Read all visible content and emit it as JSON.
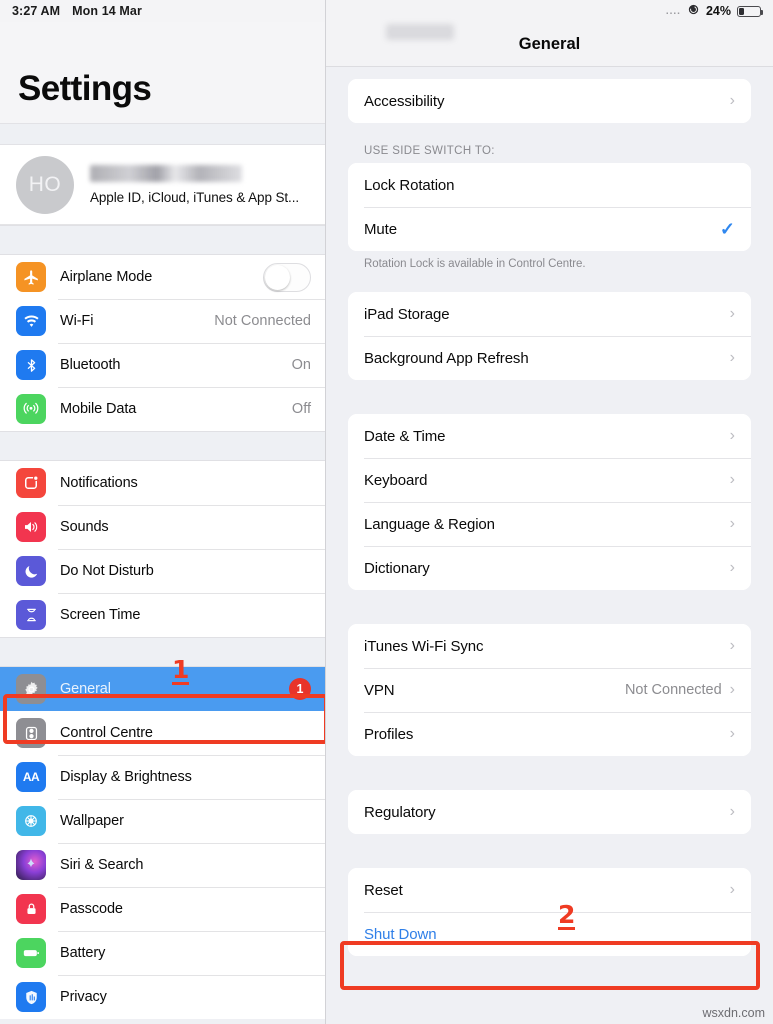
{
  "status_bar": {
    "time": "3:27 AM",
    "date": "Mon 14 Mar",
    "signal_dots": "....",
    "rotation_lock_icon": "rotation-lock-icon",
    "battery_percent": "24%"
  },
  "sidebar": {
    "title": "Settings",
    "account": {
      "avatar_initials": "HO",
      "name_redacted": "",
      "subtitle": "Apple ID, iCloud, iTunes & App St..."
    },
    "groups": [
      {
        "items": [
          {
            "label": "Airplane Mode",
            "icon": "airplane-icon",
            "icon_color": "#f59324",
            "glyph": "✈",
            "control": "toggle",
            "toggle_on": false
          },
          {
            "label": "Wi-Fi",
            "icon": "wifi-icon",
            "icon_color": "#1f7af0",
            "glyph": "◓",
            "value": "Not Connected"
          },
          {
            "label": "Bluetooth",
            "icon": "bluetooth-icon",
            "icon_color": "#1f7af0",
            "glyph": "ᛦ",
            "value": "On"
          },
          {
            "label": "Mobile Data",
            "icon": "mobile-data-icon",
            "icon_color": "#4cd55f",
            "glyph": "(·)",
            "value": "Off"
          }
        ]
      },
      {
        "items": [
          {
            "label": "Notifications",
            "icon": "notifications-icon",
            "icon_color": "#f4463c",
            "glyph": "▢"
          },
          {
            "label": "Sounds",
            "icon": "sounds-icon",
            "icon_color": "#f2354f",
            "glyph": "🔊"
          },
          {
            "label": "Do Not Disturb",
            "icon": "do-not-disturb-icon",
            "icon_color": "#5b59d8",
            "glyph": "☾"
          },
          {
            "label": "Screen Time",
            "icon": "screen-time-icon",
            "icon_color": "#5b59d8",
            "glyph": "⧖"
          }
        ]
      },
      {
        "items": [
          {
            "label": "General",
            "icon": "gear-icon",
            "icon_color": "#8e8e93",
            "glyph": "⚙",
            "selected": true,
            "badge": "1"
          },
          {
            "label": "Control Centre",
            "icon": "control-centre-icon",
            "icon_color": "#8e8e93",
            "glyph": "⚇"
          },
          {
            "label": "Display & Brightness",
            "icon": "display-brightness-icon",
            "icon_color": "#1f7af0",
            "glyph": "AA"
          },
          {
            "label": "Wallpaper",
            "icon": "wallpaper-icon",
            "icon_color": "#41b7e8",
            "glyph": "✿"
          },
          {
            "label": "Siri & Search",
            "icon": "siri-icon",
            "icon_color": "#3b2b52",
            "glyph": "✦"
          },
          {
            "label": "Passcode",
            "icon": "passcode-icon",
            "icon_color": "#f2354f",
            "glyph": "🔒"
          },
          {
            "label": "Battery",
            "icon": "battery-icon",
            "icon_color": "#4cd55f",
            "glyph": "▬"
          },
          {
            "label": "Privacy",
            "icon": "privacy-icon",
            "icon_color": "#1f7af0",
            "glyph": "✇"
          }
        ]
      }
    ]
  },
  "detail": {
    "nav_title": "General",
    "groups": [
      {
        "header": "",
        "footer": "",
        "rows": [
          {
            "label": "Accessibility",
            "chevron": true
          }
        ]
      },
      {
        "header": "USE SIDE SWITCH TO:",
        "footer": "Rotation Lock is available in Control Centre.",
        "rows": [
          {
            "label": "Lock Rotation",
            "checked": false
          },
          {
            "label": "Mute",
            "checked": true
          }
        ]
      },
      {
        "header": "",
        "footer": "",
        "rows": [
          {
            "label": "iPad Storage",
            "chevron": true
          },
          {
            "label": "Background App Refresh",
            "chevron": true
          }
        ]
      },
      {
        "header": "",
        "footer": "",
        "rows": [
          {
            "label": "Date & Time",
            "chevron": true
          },
          {
            "label": "Keyboard",
            "chevron": true
          },
          {
            "label": "Language & Region",
            "chevron": true
          },
          {
            "label": "Dictionary",
            "chevron": true
          }
        ]
      },
      {
        "header": "",
        "footer": "",
        "rows": [
          {
            "label": "iTunes Wi-Fi Sync",
            "chevron": true
          },
          {
            "label": "VPN",
            "value": "Not Connected",
            "chevron": true
          },
          {
            "label": "Profiles",
            "chevron": true
          }
        ]
      },
      {
        "header": "",
        "footer": "",
        "rows": [
          {
            "label": "Regulatory",
            "chevron": true
          }
        ]
      },
      {
        "header": "",
        "footer": "",
        "rows": [
          {
            "label": "Reset",
            "chevron": true
          },
          {
            "label": "Shut Down",
            "link": true
          }
        ]
      }
    ]
  },
  "annotations": [
    {
      "number": "1",
      "target": "general-sidebar-row"
    },
    {
      "number": "2",
      "target": "shut-down-row"
    }
  ],
  "watermark": "wsxdn.com",
  "colors": {
    "accent_blue": "#4a9bf0",
    "link_blue": "#2f7fe8",
    "annotation_red": "#ef3b23",
    "badge_red": "#e8342a"
  }
}
